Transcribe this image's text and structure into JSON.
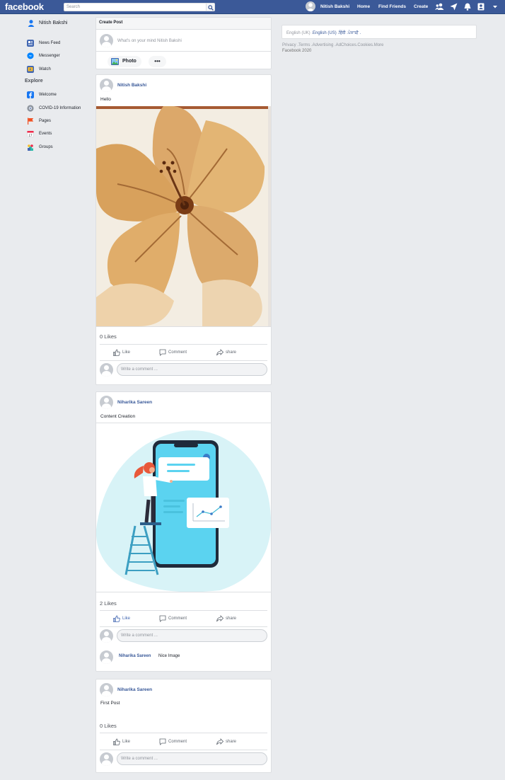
{
  "topbar": {
    "logo": "facebook",
    "search_placeholder": "Search",
    "user_name": "Nitish Bakshi",
    "home": "Home",
    "find_friends": "Find Friends",
    "create": "Create"
  },
  "sidebar": {
    "user_name": "Nitish Bakshi",
    "items": [
      {
        "label": "News Feed",
        "icon": "news-feed-icon",
        "color": "#4267b2"
      },
      {
        "label": "Messenger",
        "icon": "messenger-icon",
        "color": "#0084ff"
      },
      {
        "label": "Watch",
        "icon": "watch-icon",
        "color": "#4267b2"
      }
    ],
    "explore_heading": "Explore",
    "explore_items": [
      {
        "label": "Welcome",
        "icon": "facebook-f-icon",
        "color": "#1877f2"
      },
      {
        "label": "COVID-19 Information",
        "icon": "covid-info-icon",
        "color": "#8d949e"
      },
      {
        "label": "Pages",
        "icon": "flag-icon",
        "color": "#f25022"
      },
      {
        "label": "Events",
        "icon": "calendar-icon",
        "color": "#f02849"
      },
      {
        "label": "Groups",
        "icon": "groups-icon",
        "color": "#2abba7"
      }
    ]
  },
  "create_post": {
    "heading": "Create Post",
    "placeholder": "What's on your mind Nitish Bakshi",
    "photo_label": "Photo",
    "more_label": "•••"
  },
  "posts": [
    {
      "author": "Nitish Bakshi",
      "text": "Hello",
      "image": "hibiscus-flower",
      "likes": "0 Likes",
      "liked": false,
      "comment_placeholder": "Write a comment ...",
      "comments": []
    },
    {
      "author": "Niharika Sareen",
      "text": "Content Creation",
      "image": "phone-illustration",
      "likes": "2 Likes",
      "liked": true,
      "comment_placeholder": "Write a comment ...",
      "comments": [
        {
          "author": "Niharika Sareen",
          "text": "Nice Image"
        }
      ]
    },
    {
      "author": "Niharika Sareen",
      "text": "First Post",
      "image": "",
      "likes": "0 Likes",
      "liked": false,
      "comment_placeholder": "Write a comment ...",
      "comments": []
    }
  ],
  "actions": {
    "like": "Like",
    "comment": "Comment",
    "share": "share"
  },
  "right": {
    "languages": {
      "english_uk": "English (UK)",
      "english_us": "English (US)",
      "hindi": "हिंदी",
      "punjabi": "ਪੰਜਾਬੀ"
    },
    "footer_links": "Privacy .Terms .Advertising .AdChoices.Cookies.More",
    "copyright": "Facebook 2020"
  },
  "colors": {
    "brand": "#3b5998",
    "link": "#385898",
    "background": "#e9ebee"
  }
}
